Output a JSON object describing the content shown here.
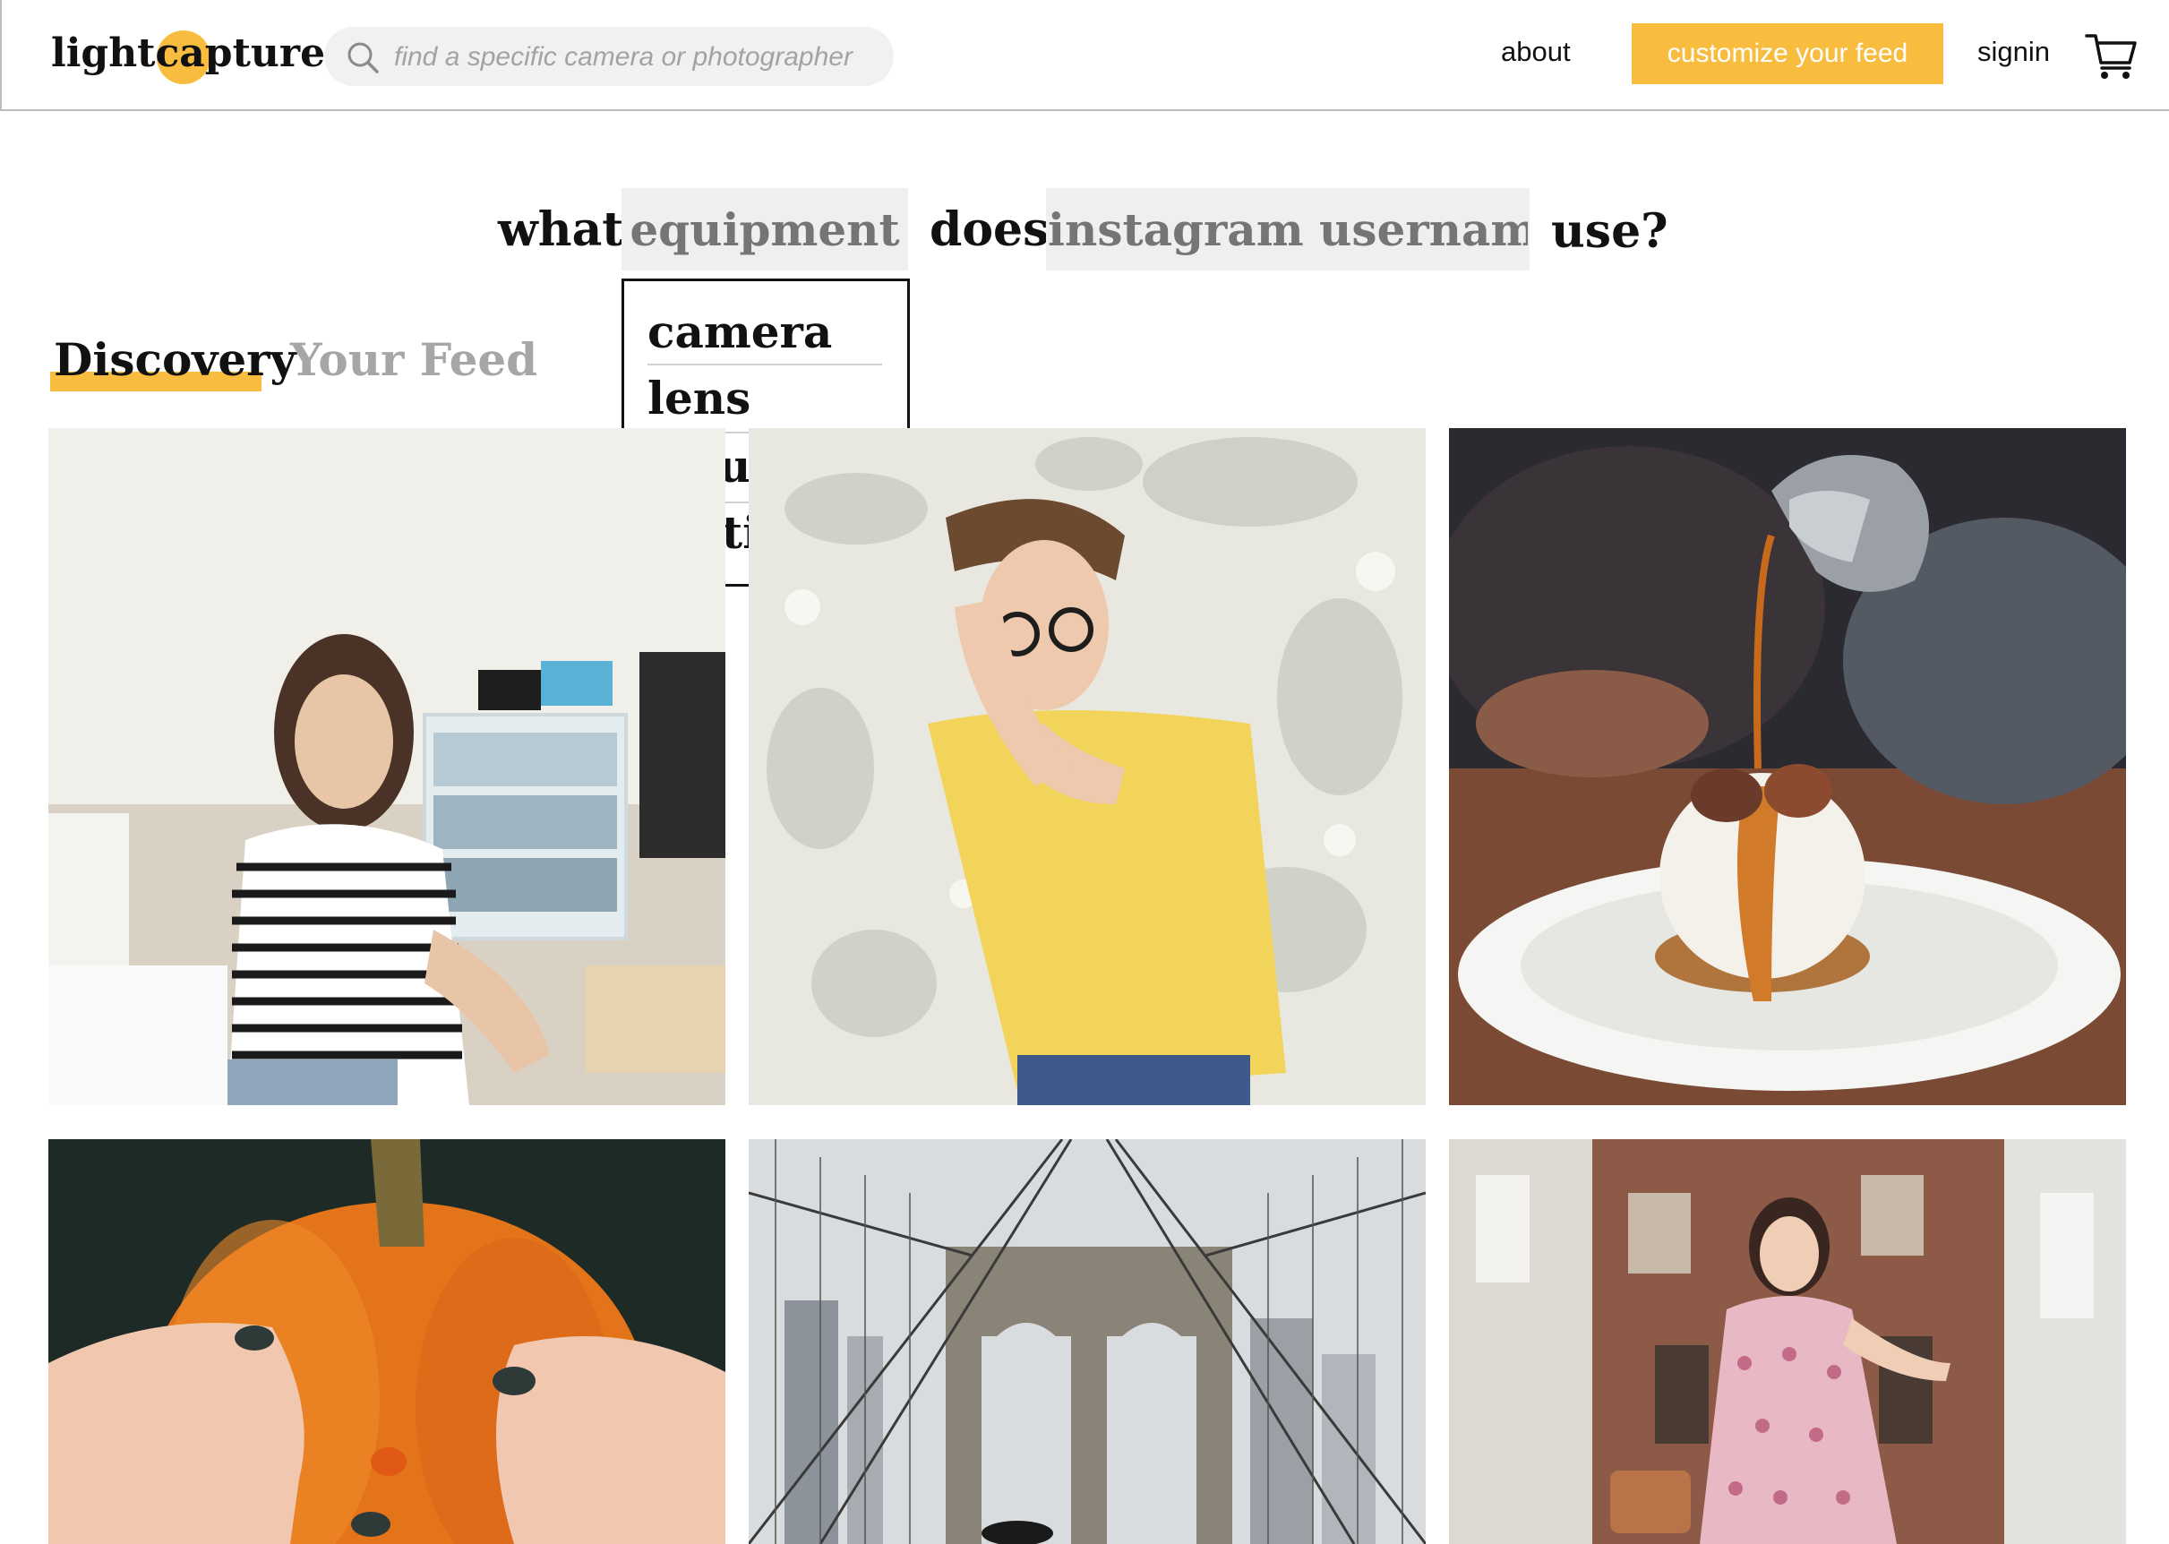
{
  "app": {
    "logo_text": "lightcapture",
    "accent_color": "#f8bc3f"
  },
  "header": {
    "search_placeholder": "find a specific camera or photographer",
    "about_label": "about",
    "cta_label": "customize your feed",
    "signin_label": "signin"
  },
  "question": {
    "word_what": "what",
    "equipment_placeholder": "equipment",
    "word_does": "does",
    "username_placeholder": "instagram username",
    "word_use": "use?"
  },
  "dropdown": {
    "items": [
      "camera",
      "lens",
      "setup",
      "settings"
    ]
  },
  "tabs": {
    "active": "Discovery",
    "inactive": "Your Feed"
  },
  "icons": {
    "search": "search-icon",
    "cart": "cart-icon"
  }
}
